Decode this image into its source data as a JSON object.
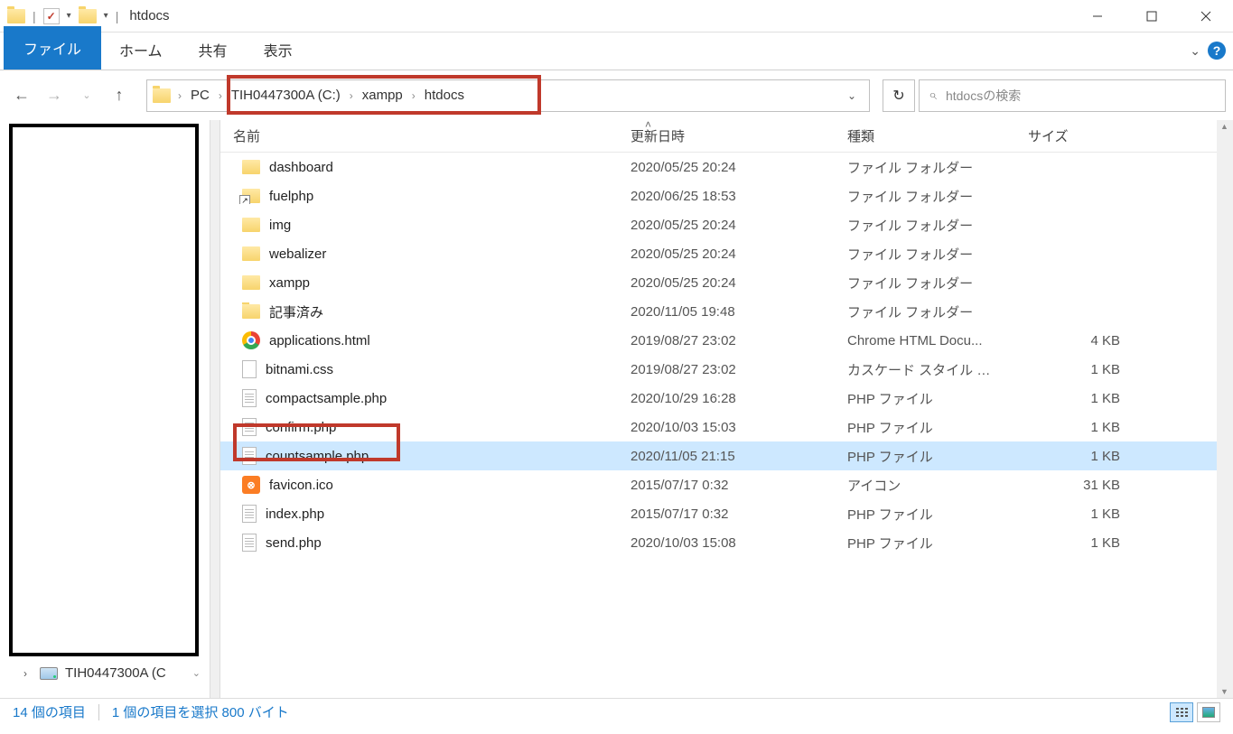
{
  "window": {
    "title": "htdocs"
  },
  "ribbon": {
    "file": "ファイル",
    "home": "ホーム",
    "share": "共有",
    "view": "表示"
  },
  "breadcrumb": {
    "pc": "PC",
    "drive": "TIH0447300A (C:)",
    "xampp": "xampp",
    "htdocs": "htdocs"
  },
  "search": {
    "placeholder": "htdocsの検索"
  },
  "columns": {
    "name": "名前",
    "date": "更新日時",
    "type": "種類",
    "size": "サイズ"
  },
  "files": [
    {
      "name": "dashboard",
      "date": "2020/05/25 20:24",
      "type": "ファイル フォルダー",
      "size": "",
      "icon": "folder"
    },
    {
      "name": "fuelphp",
      "date": "2020/06/25 18:53",
      "type": "ファイル フォルダー",
      "size": "",
      "icon": "folder-shortcut"
    },
    {
      "name": "img",
      "date": "2020/05/25 20:24",
      "type": "ファイル フォルダー",
      "size": "",
      "icon": "folder"
    },
    {
      "name": "webalizer",
      "date": "2020/05/25 20:24",
      "type": "ファイル フォルダー",
      "size": "",
      "icon": "folder"
    },
    {
      "name": "xampp",
      "date": "2020/05/25 20:24",
      "type": "ファイル フォルダー",
      "size": "",
      "icon": "folder"
    },
    {
      "name": "記事済み",
      "date": "2020/11/05 19:48",
      "type": "ファイル フォルダー",
      "size": "",
      "icon": "folder"
    },
    {
      "name": "applications.html",
      "date": "2019/08/27 23:02",
      "type": "Chrome HTML Docu...",
      "size": "4 KB",
      "icon": "chrome"
    },
    {
      "name": "bitnami.css",
      "date": "2019/08/27 23:02",
      "type": "カスケード スタイル シート...",
      "size": "1 KB",
      "icon": "css"
    },
    {
      "name": "compactsample.php",
      "date": "2020/10/29 16:28",
      "type": "PHP ファイル",
      "size": "1 KB",
      "icon": "file"
    },
    {
      "name": "confirm.php",
      "date": "2020/10/03 15:03",
      "type": "PHP ファイル",
      "size": "1 KB",
      "icon": "file"
    },
    {
      "name": "countsample.php",
      "date": "2020/11/05 21:15",
      "type": "PHP ファイル",
      "size": "1 KB",
      "icon": "file",
      "selected": true,
      "highlighted": true
    },
    {
      "name": "favicon.ico",
      "date": "2015/07/17 0:32",
      "type": "アイコン",
      "size": "31 KB",
      "icon": "xampp"
    },
    {
      "name": "index.php",
      "date": "2015/07/17 0:32",
      "type": "PHP ファイル",
      "size": "1 KB",
      "icon": "file"
    },
    {
      "name": "send.php",
      "date": "2020/10/03 15:08",
      "type": "PHP ファイル",
      "size": "1 KB",
      "icon": "file"
    }
  ],
  "tree": {
    "drive_label": "TIH0447300A (C"
  },
  "status": {
    "count": "14 個の項目",
    "selection": "1 個の項目を選択 800 バイト"
  }
}
